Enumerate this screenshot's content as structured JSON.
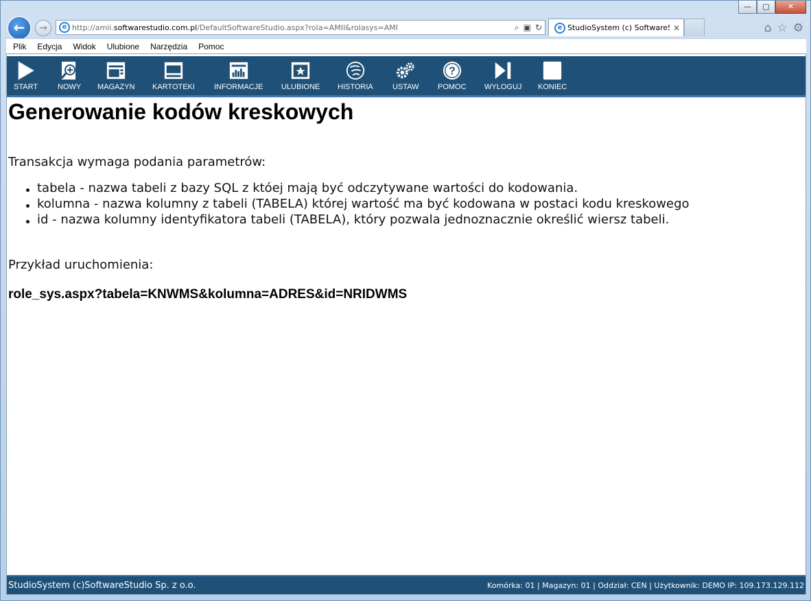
{
  "browser": {
    "url_prefix": "http://amii.",
    "url_domain": "softwarestudio.com.pl",
    "url_rest": "/DefaultSoftwareStudio.aspx?rola=AMII&rolasys=AMI",
    "tab_title": "StudioSystem (c) SoftwareS...",
    "tab_close": "✕",
    "win_min": "—",
    "win_max": "▢",
    "win_close": "✕"
  },
  "menubar": {
    "items": [
      "Plik",
      "Edycja",
      "Widok",
      "Ulubione",
      "Narzędzia",
      "Pomoc"
    ]
  },
  "toolbar": {
    "buttons": [
      {
        "label": "START",
        "icon": "play-icon"
      },
      {
        "label": "NOWY",
        "icon": "new-document-icon"
      },
      {
        "label": "MAGAZYN",
        "icon": "warehouse-icon"
      },
      {
        "label": "KARTOTEKI",
        "icon": "index-cards-icon"
      },
      {
        "label": "INFORMACJE",
        "icon": "bar-chart-icon"
      },
      {
        "label": "ULUBIONE",
        "icon": "star-icon"
      },
      {
        "label": "HISTORIA",
        "icon": "history-icon"
      },
      {
        "label": "USTAW",
        "icon": "gears-icon"
      },
      {
        "label": "POMOC",
        "icon": "help-icon"
      },
      {
        "label": "WYLOGUJ",
        "icon": "logout-icon"
      },
      {
        "label": "KONIEC",
        "icon": "stop-icon"
      }
    ]
  },
  "main": {
    "title": "Generowanie kodów kreskowych",
    "intro": "Transakcja wymaga podania parametrów:",
    "params": [
      "tabela - nazwa tabeli z bazy SQL z któej mają być odczytywane wartości do kodowania.",
      "kolumna - nazwa kolumny z tabeli (TABELA) której wartość ma być kodowana w postaci kodu kreskowego",
      "id - nazwa kolumny identyfikatora tabeli (TABELA), który pozwala jednoznacznie określić wiersz tabeli."
    ],
    "example_label": "Przykład uruchomienia:",
    "example_code": "role_sys.aspx?tabela=KNWMS&kolumna=ADRES&id=NRIDWMS"
  },
  "footer": {
    "left": "StudioSystem (c)SoftwareStudio Sp. z o.o.",
    "right": "Komórka: 01 | Magazyn: 01 | Oddział: CEN | Użytkownik: DEMO IP: 109.173.129.112"
  },
  "colors": {
    "toolbar_bg": "#1f5178",
    "toolbar_accent": "#3b79b0"
  }
}
